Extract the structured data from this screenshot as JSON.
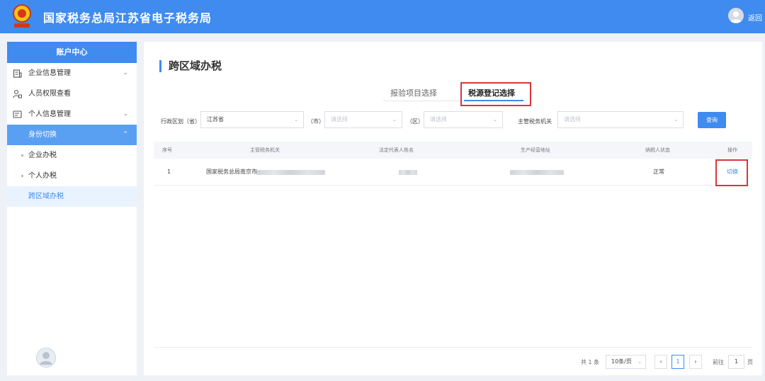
{
  "header": {
    "title": "国家税务总局江苏省电子税务局",
    "back_label": "返回",
    "brand_color": "#3f8bf0"
  },
  "sidebar": {
    "head": "账户中心",
    "items": [
      {
        "label": "企业信息管理",
        "icon": "building-icon",
        "expanded": false
      },
      {
        "label": "人员权限查看",
        "icon": "user-lock-icon"
      },
      {
        "label": "个人信息管理",
        "icon": "id-card-icon",
        "expanded": false
      },
      {
        "label": "身份切换",
        "active": true,
        "expanded": true
      }
    ],
    "sub_items": [
      {
        "label": "企业办税"
      },
      {
        "label": "个人办税"
      },
      {
        "label": "跨区域办税",
        "selected": true
      }
    ]
  },
  "main": {
    "title": "跨区域办税",
    "tabs": [
      {
        "label": "报验项目选择"
      },
      {
        "label": "税源登记选择",
        "active": true
      }
    ],
    "filters": {
      "province_label": "行政区划（省）",
      "province_value": "江苏省",
      "city_label": "（市）",
      "city_placeholder": "请选择",
      "district_label": "（区）",
      "district_placeholder": "请选择",
      "authority_label": "主管税务机关",
      "authority_placeholder": "请选择",
      "query_label": "查询"
    },
    "table": {
      "columns": [
        "序号",
        "主管税务机关",
        "法定代表人姓名",
        "生产经营地址",
        "纳税人状态",
        "操作"
      ],
      "rows": [
        {
          "index": "1",
          "authority": "国家税务总局南京市",
          "status": "正常",
          "action": "切换"
        }
      ]
    },
    "pagination": {
      "total": "共 1 条",
      "page_size": "10条/页",
      "prev": "‹",
      "current": "1",
      "next": "›",
      "goto_label": "前往",
      "goto_value": "1",
      "page_unit": "页"
    }
  },
  "colors": {
    "highlight": "#d8363b",
    "sidebar_active": "#5aa0f2"
  }
}
